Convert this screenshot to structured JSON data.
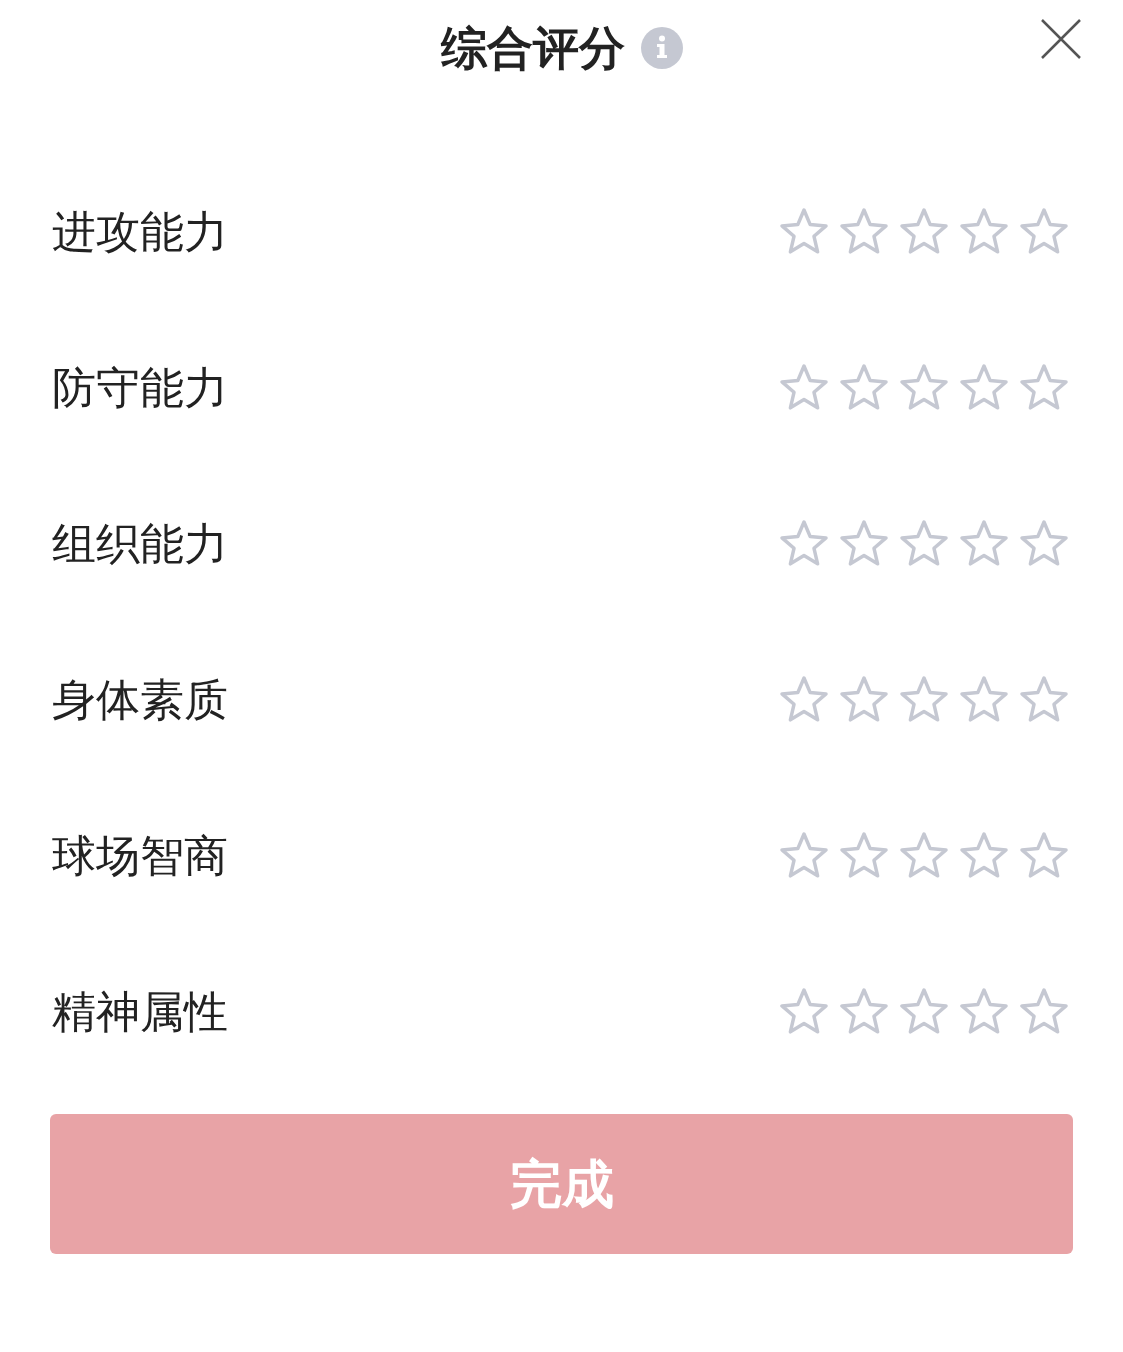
{
  "title": "综合评分",
  "ratings": [
    {
      "label": "进攻能力",
      "stars": 0
    },
    {
      "label": "防守能力",
      "stars": 0
    },
    {
      "label": "组织能力",
      "stars": 0
    },
    {
      "label": "身体素质",
      "stars": 0
    },
    {
      "label": "球场智商",
      "stars": 0
    },
    {
      "label": "精神属性",
      "stars": 0
    }
  ],
  "button": {
    "label": "完成",
    "disabled": true
  }
}
